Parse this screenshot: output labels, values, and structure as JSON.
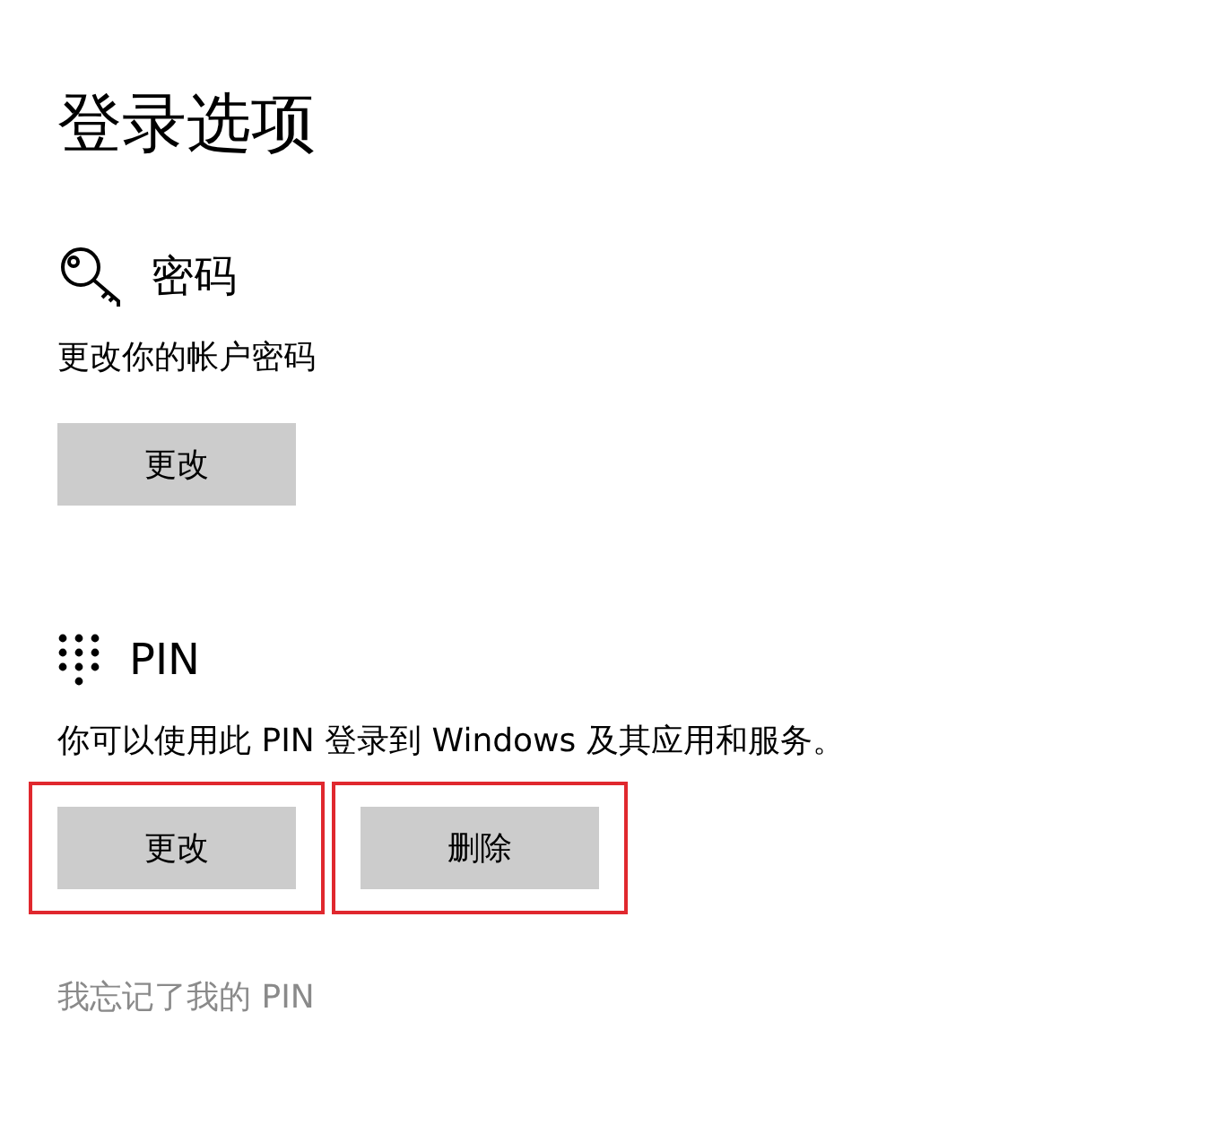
{
  "page_title": "登录选项",
  "sections": [
    {
      "kind": "password",
      "title": "密码",
      "description": "更改你的帐户密码",
      "buttons": [
        {
          "label": "更改",
          "highlighted": false
        }
      ]
    },
    {
      "kind": "pin",
      "title": "PIN",
      "description": "你可以使用此 PIN 登录到 Windows 及其应用和服务。",
      "buttons": [
        {
          "label": "更改",
          "highlighted": true
        },
        {
          "label": "删除",
          "highlighted": true
        }
      ]
    }
  ],
  "link": "我忘记了我的 PIN"
}
